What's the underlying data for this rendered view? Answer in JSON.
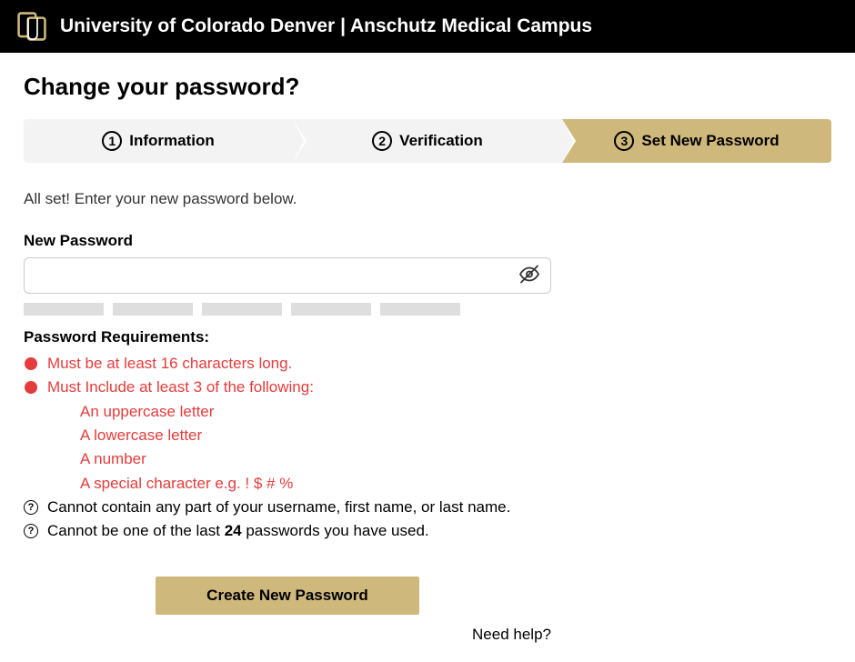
{
  "header": {
    "site_title": "University of Colorado Denver | Anschutz Medical Campus"
  },
  "page": {
    "title": "Change your password?",
    "instruction": "All set! Enter your new password below."
  },
  "stepper": {
    "steps": [
      {
        "num": "1",
        "label": "Information"
      },
      {
        "num": "2",
        "label": "Verification"
      },
      {
        "num": "3",
        "label": "Set New Password"
      }
    ],
    "active_index": 2
  },
  "form": {
    "new_password_label": "New Password",
    "new_password_value": "",
    "submit_label": "Create New Password",
    "help_label": "Need help?"
  },
  "requirements": {
    "title": "Password Requirements:",
    "items": [
      {
        "icon": "red-dot",
        "text": "Must be at least 16 characters long.",
        "status": "unmet"
      },
      {
        "icon": "red-dot",
        "text": "Must Include at least 3 of the following:",
        "status": "unmet"
      }
    ],
    "sub_items": [
      "An uppercase letter",
      "A lowercase letter",
      "A number",
      "A special character e.g. ! $ # %"
    ],
    "info_items": [
      {
        "icon": "question",
        "text": "Cannot contain any part of your username, first name, or last name."
      },
      {
        "icon": "question",
        "text_prefix": "Cannot be one of the last ",
        "count": "24",
        "text_suffix": " passwords you have used."
      }
    ]
  },
  "colors": {
    "accent": "#cfb87c",
    "error": "#e43c3c"
  }
}
